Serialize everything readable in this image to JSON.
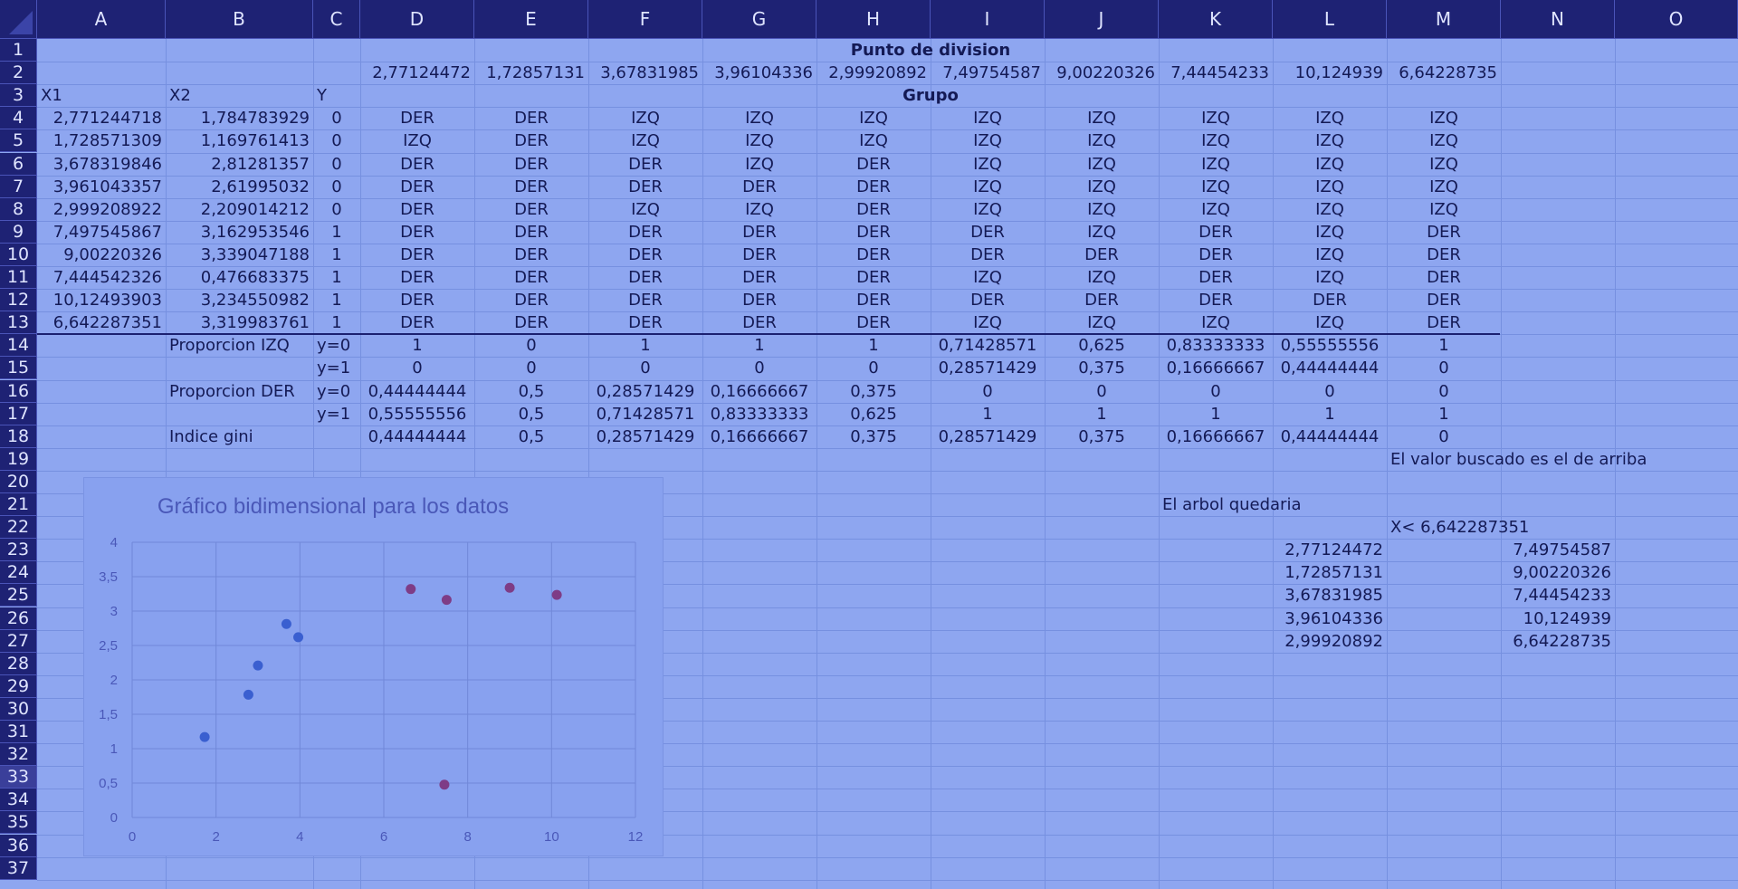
{
  "columns": [
    "A",
    "B",
    "C",
    "D",
    "E",
    "F",
    "G",
    "H",
    "I",
    "J",
    "K",
    "L",
    "M",
    "N",
    "O"
  ],
  "rows": [
    "1",
    "2",
    "3",
    "4",
    "5",
    "6",
    "7",
    "8",
    "9",
    "10",
    "11",
    "12",
    "13",
    "14",
    "15",
    "16",
    "17",
    "18",
    "19",
    "20",
    "21",
    "22",
    "23",
    "24",
    "25",
    "26",
    "27",
    "28",
    "29",
    "30",
    "31",
    "32",
    "33",
    "34",
    "35",
    "36",
    "37"
  ],
  "active_row": "33",
  "cells": {
    "D1": "Punto de division",
    "D2": "2,77124472",
    "E2": "1,72857131",
    "F2": "3,67831985",
    "G2": "3,96104336",
    "H2": "2,99920892",
    "I2": "7,49754587",
    "J2": "9,00220326",
    "K2": "7,44454233",
    "L2": "10,124939",
    "M2": "6,64228735",
    "A3": "X1",
    "B3": "X2",
    "C3": "Y",
    "D3": "Grupo",
    "A4": "2,771244718",
    "B4": "1,784783929",
    "C4": "0",
    "A5": "1,728571309",
    "B5": "1,169761413",
    "C5": "0",
    "A6": "3,678319846",
    "B6": "2,81281357",
    "C6": "0",
    "A7": "3,961043357",
    "B7": "2,61995032",
    "C7": "0",
    "A8": "2,999208922",
    "B8": "2,209014212",
    "C8": "0",
    "A9": "7,497545867",
    "B9": "3,162953546",
    "C9": "1",
    "A10": "9,00220326",
    "B10": "3,339047188",
    "C10": "1",
    "A11": "7,444542326",
    "B11": "0,476683375",
    "C11": "1",
    "A12": "10,12493903",
    "B12": "3,234550982",
    "C12": "1",
    "A13": "6,642287351",
    "B13": "3,319983761",
    "C13": "1",
    "B14": "Proporcion IZQ",
    "C14": "y=0",
    "D14": "1",
    "E14": "0",
    "F14": "1",
    "G14": "1",
    "H14": "1",
    "I14": "0,71428571",
    "J14": "0,625",
    "K14": "0,83333333",
    "L14": "0,55555556",
    "M14": "1",
    "C15": "y=1",
    "D15": "0",
    "E15": "0",
    "F15": "0",
    "G15": "0",
    "H15": "0",
    "I15": "0,28571429",
    "J15": "0,375",
    "K15": "0,16666667",
    "L15": "0,44444444",
    "M15": "0",
    "B16": "Proporcion DER",
    "C16": "y=0",
    "D16": "0,44444444",
    "E16": "0,5",
    "F16": "0,28571429",
    "G16": "0,16666667",
    "H16": "0,375",
    "I16": "0",
    "J16": "0",
    "K16": "0",
    "L16": "0",
    "M16": "0",
    "C17": "y=1",
    "D17": "0,55555556",
    "E17": "0,5",
    "F17": "0,71428571",
    "G17": "0,83333333",
    "H17": "0,625",
    "I17": "1",
    "J17": "1",
    "K17": "1",
    "L17": "1",
    "M17": "1",
    "B18": "Indice gini",
    "D18": "0,44444444",
    "E18": "0,5",
    "F18": "0,28571429",
    "G18": "0,16666667",
    "H18": "0,375",
    "I18": "0,28571429",
    "J18": "0,375",
    "K18": "0,16666667",
    "L18": "0,44444444",
    "M18": "0",
    "M19": "El valor buscado es el de arriba",
    "K21": "El arbol quedaria",
    "M22": "X< 6,642287351",
    "L23": "2,77124472",
    "N23": "7,49754587",
    "L24": "1,72857131",
    "N24": "9,00220326",
    "L25": "3,67831985",
    "N25": "7,44454233",
    "L26": "3,96104336",
    "N26": "10,124939",
    "L27": "2,99920892",
    "N27": "6,64228735"
  },
  "grupo": [
    [
      "DER",
      "DER",
      "IZQ",
      "IZQ",
      "IZQ",
      "IZQ",
      "IZQ",
      "IZQ",
      "IZQ",
      "IZQ"
    ],
    [
      "IZQ",
      "DER",
      "IZQ",
      "IZQ",
      "IZQ",
      "IZQ",
      "IZQ",
      "IZQ",
      "IZQ",
      "IZQ"
    ],
    [
      "DER",
      "DER",
      "DER",
      "IZQ",
      "DER",
      "IZQ",
      "IZQ",
      "IZQ",
      "IZQ",
      "IZQ"
    ],
    [
      "DER",
      "DER",
      "DER",
      "DER",
      "DER",
      "IZQ",
      "IZQ",
      "IZQ",
      "IZQ",
      "IZQ"
    ],
    [
      "DER",
      "DER",
      "IZQ",
      "IZQ",
      "DER",
      "IZQ",
      "IZQ",
      "IZQ",
      "IZQ",
      "IZQ"
    ],
    [
      "DER",
      "DER",
      "DER",
      "DER",
      "DER",
      "DER",
      "IZQ",
      "DER",
      "IZQ",
      "DER"
    ],
    [
      "DER",
      "DER",
      "DER",
      "DER",
      "DER",
      "DER",
      "DER",
      "DER",
      "IZQ",
      "DER"
    ],
    [
      "DER",
      "DER",
      "DER",
      "DER",
      "DER",
      "IZQ",
      "IZQ",
      "DER",
      "IZQ",
      "DER"
    ],
    [
      "DER",
      "DER",
      "DER",
      "DER",
      "DER",
      "DER",
      "DER",
      "DER",
      "DER",
      "DER"
    ],
    [
      "DER",
      "DER",
      "DER",
      "DER",
      "DER",
      "IZQ",
      "IZQ",
      "IZQ",
      "IZQ",
      "DER"
    ]
  ],
  "chart_data": {
    "type": "scatter",
    "title": "Gráfico bidimensional para los datos",
    "xlabel": "",
    "ylabel": "",
    "xlim": [
      0,
      12
    ],
    "ylim": [
      0,
      4
    ],
    "xticks": [
      "0",
      "2",
      "4",
      "6",
      "8",
      "10",
      "12"
    ],
    "yticks": [
      "0",
      "0,5",
      "1",
      "1,5",
      "2",
      "2,5",
      "3",
      "3,5",
      "4"
    ],
    "grid": true,
    "series": [
      {
        "color": "#3a5fd0",
        "x": [
          2.7712,
          1.7286,
          3.6783,
          3.961,
          2.9992
        ],
        "y": [
          1.7848,
          1.1698,
          2.8128,
          2.62,
          2.209
        ]
      },
      {
        "color": "#7e3c86",
        "x": [
          7.4975,
          9.0022,
          7.4445,
          10.1249,
          6.6423
        ],
        "y": [
          3.163,
          3.339,
          0.4767,
          3.2346,
          3.32
        ]
      }
    ]
  }
}
